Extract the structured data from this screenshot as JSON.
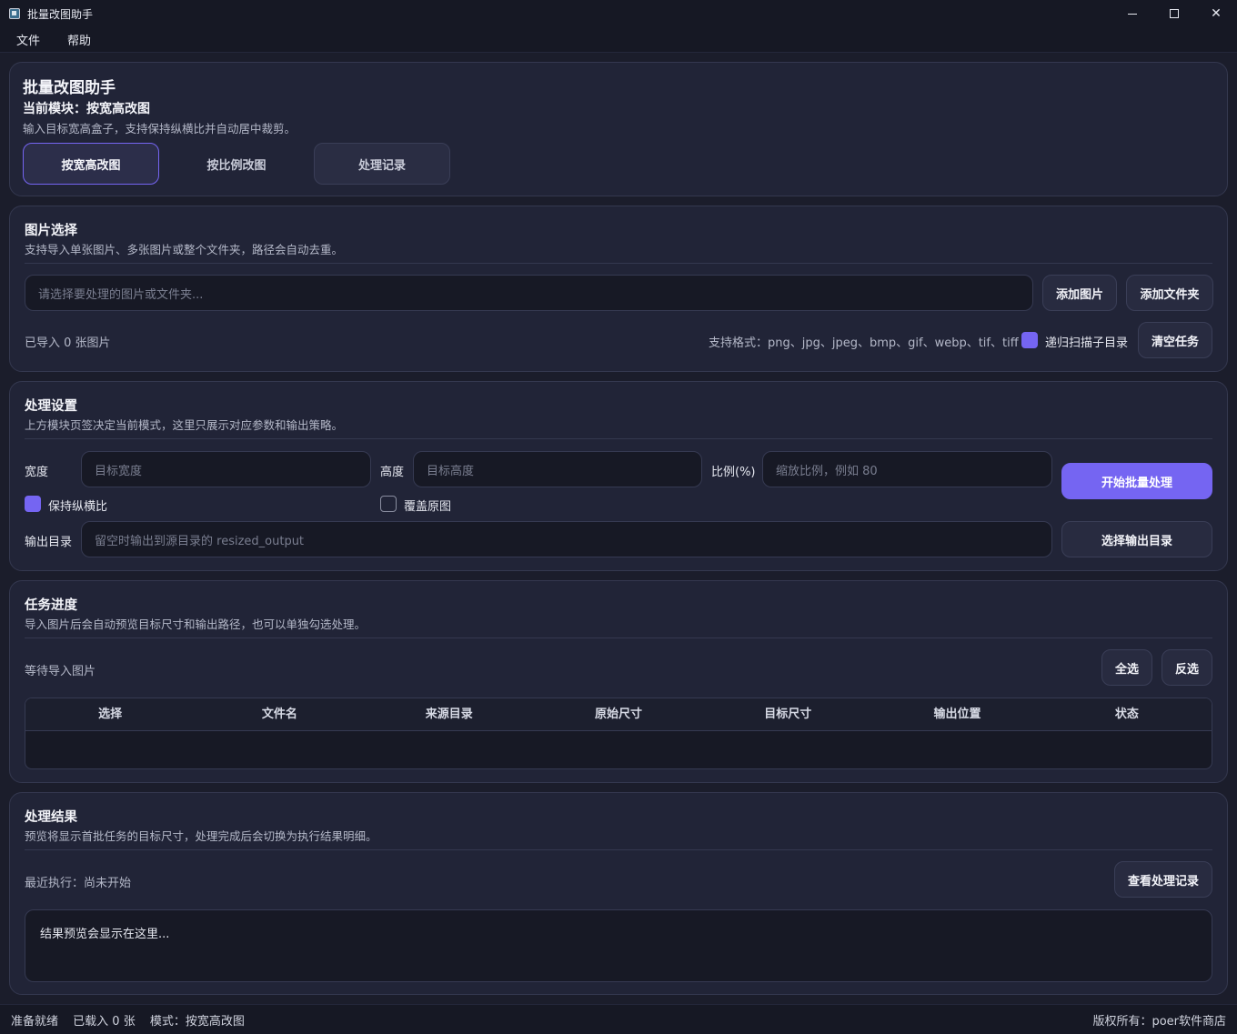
{
  "window": {
    "title": "批量改图助手",
    "minimize": "",
    "maximize": "",
    "close": "✕"
  },
  "menu": [
    "文件",
    "帮助"
  ],
  "header": {
    "app_title": "批量改图助手",
    "current_module": "当前模块：按宽高改图",
    "desc": "输入目标宽高盒子，支持保持纵横比并自动居中裁剪。",
    "tabs": [
      "按宽高改图",
      "按比例改图",
      "处理记录"
    ]
  },
  "image_select": {
    "title": "图片选择",
    "desc": "支持导入单张图片、多张图片或整个文件夹，路径会自动去重。",
    "path_placeholder": "请选择要处理的图片或文件夹...",
    "add_images": "添加图片",
    "add_folder": "添加文件夹",
    "imported": "已导入 0 张图片",
    "formats": "支持格式：png、jpg、jpeg、bmp、gif、webp、tif、tiff",
    "recursive_label": "递归扫描子目录",
    "clear": "清空任务"
  },
  "settings": {
    "title": "处理设置",
    "desc": "上方模块页签决定当前模式，这里只展示对应参数和输出策略。",
    "width_label": "宽度",
    "width_placeholder": "目标宽度",
    "height_label": "高度",
    "height_placeholder": "目标高度",
    "ratio_label": "比例(%)",
    "ratio_placeholder": "缩放比例，例如 80",
    "start": "开始批量处理",
    "keep_ratio": "保持纵横比",
    "overwrite": "覆盖原图",
    "output_label": "输出目录",
    "output_placeholder": "留空时输出到源目录的 resized_output",
    "choose_output": "选择输出目录"
  },
  "progress": {
    "title": "任务进度",
    "desc": "导入图片后会自动预览目标尺寸和输出路径，也可以单独勾选处理。",
    "status": "等待导入图片",
    "select_all": "全选",
    "invert": "反选",
    "columns": [
      "选择",
      "文件名",
      "来源目录",
      "原始尺寸",
      "目标尺寸",
      "输出位置",
      "状态"
    ]
  },
  "result": {
    "title": "处理结果",
    "desc": "预览将显示首批任务的目标尺寸，处理完成后会切换为执行结果明细。",
    "last_run": "最近执行：尚未开始",
    "view_records": "查看处理记录",
    "preview": "结果预览会显示在这里..."
  },
  "statusbar": {
    "ready": "准备就绪",
    "loaded": "已载入 0 张",
    "mode": "模式：按宽高改图",
    "copyright": "版权所有：poer软件商店"
  },
  "colors": {
    "accent": "#7565f2",
    "background": "#1b1d2b",
    "card": "#212437"
  }
}
